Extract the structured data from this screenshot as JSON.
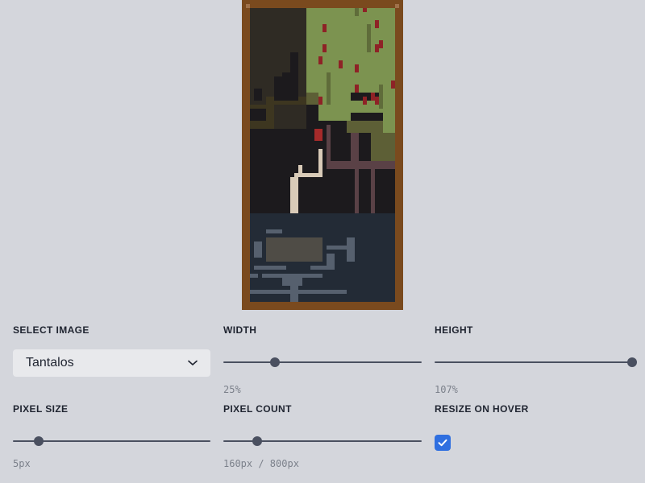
{
  "colors": {
    "frame": "#7a4a1e",
    "accent": "#2f6fe0",
    "slider": "#4a5060",
    "background": "#d4d6dc"
  },
  "controls": {
    "select_image": {
      "label": "Select Image",
      "value": "Tantalos",
      "icon": "chevron-down-icon"
    },
    "width": {
      "label": "Width",
      "readout": "25%",
      "value_fraction": 0.26
    },
    "height": {
      "label": "Height",
      "readout": "107%",
      "value_fraction": 1.0
    },
    "pixel_size": {
      "label": "Pixel Size",
      "readout": "5px",
      "value_fraction": 0.13
    },
    "pixel_count": {
      "label": "Pixel Count",
      "readout": "160px / 800px",
      "value_fraction": 0.17
    },
    "resize_on_hover": {
      "label": "Resize on hover",
      "checked": true,
      "icon": "check-icon"
    }
  }
}
